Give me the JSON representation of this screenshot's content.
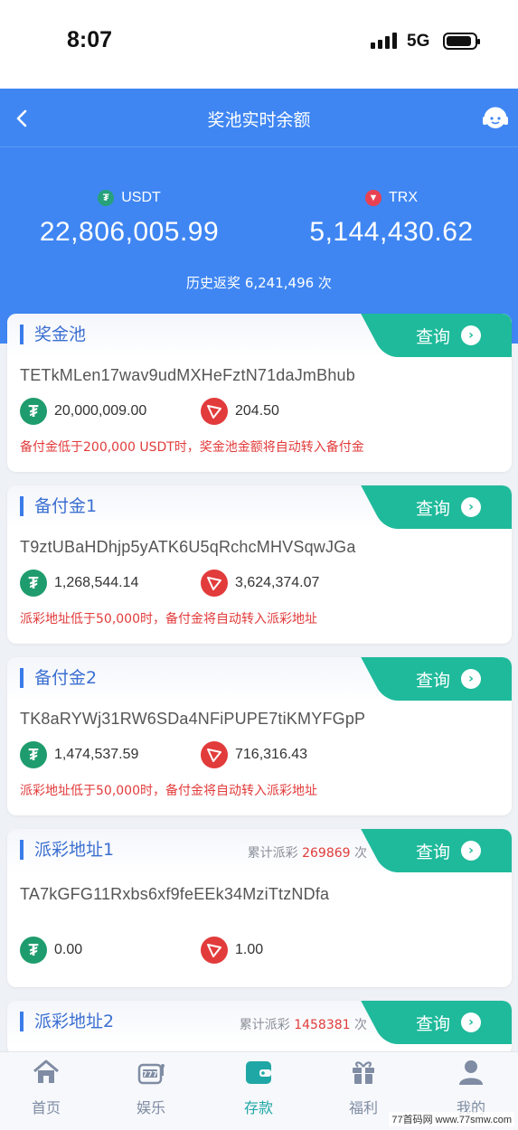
{
  "status": {
    "time": "8:07",
    "network": "5G"
  },
  "nav": {
    "title": "奖池实时余额"
  },
  "summary": {
    "usdt_label": "USDT",
    "usdt_amount": "22,806,005.99",
    "trx_label": "TRX",
    "trx_amount": "5,144,430.62",
    "history": "历史返奖 6,241,496 次"
  },
  "query_label": "查询",
  "cards": [
    {
      "title": "奖金池",
      "address": "TETkMLen17wav9udMXHeFztN71daJmBhub",
      "usdt": "20,000,009.00",
      "trx": "204.50",
      "note": "备付金低于200,000 USDT时，奖金池金额将自动转入备付金"
    },
    {
      "title": "备付金1",
      "address": "T9ztUBaHDhjp5yATK6U5qRchcMHVSqwJGa",
      "usdt": "1,268,544.14",
      "trx": "3,624,374.07",
      "note": "派彩地址低于50,000时，备付金将自动转入派彩地址"
    },
    {
      "title": "备付金2",
      "address": "TK8aRYWj31RW6SDa4NFiPUPE7tiKMYFGpP",
      "usdt": "1,474,537.59",
      "trx": "716,316.43",
      "note": "派彩地址低于50,000时，备付金将自动转入派彩地址"
    },
    {
      "title": "派彩地址1",
      "stat_prefix": "累计派彩",
      "stat_count": "269869",
      "stat_suffix": "次",
      "address": "TA7kGFG11Rxbs6xf9feEEk34MziTtzNDfa",
      "usdt": "0.00",
      "trx": "1.00"
    },
    {
      "title": "派彩地址2",
      "stat_prefix": "累计派彩",
      "stat_count": "1458381",
      "stat_suffix": "次"
    }
  ],
  "tabs": [
    {
      "label": "首页",
      "icon": "home-icon"
    },
    {
      "label": "娱乐",
      "icon": "slot-machine-icon"
    },
    {
      "label": "存款",
      "icon": "wallet-icon"
    },
    {
      "label": "福利",
      "icon": "gift-icon"
    },
    {
      "label": "我的",
      "icon": "user-icon"
    }
  ],
  "active_tab": "存款",
  "watermark": "77首码网 www.77smw.com",
  "colors": {
    "primary": "#3f86f3",
    "teal": "#1fba9b",
    "red": "#e23b3b",
    "usdt_green": "#1f9c6d"
  }
}
